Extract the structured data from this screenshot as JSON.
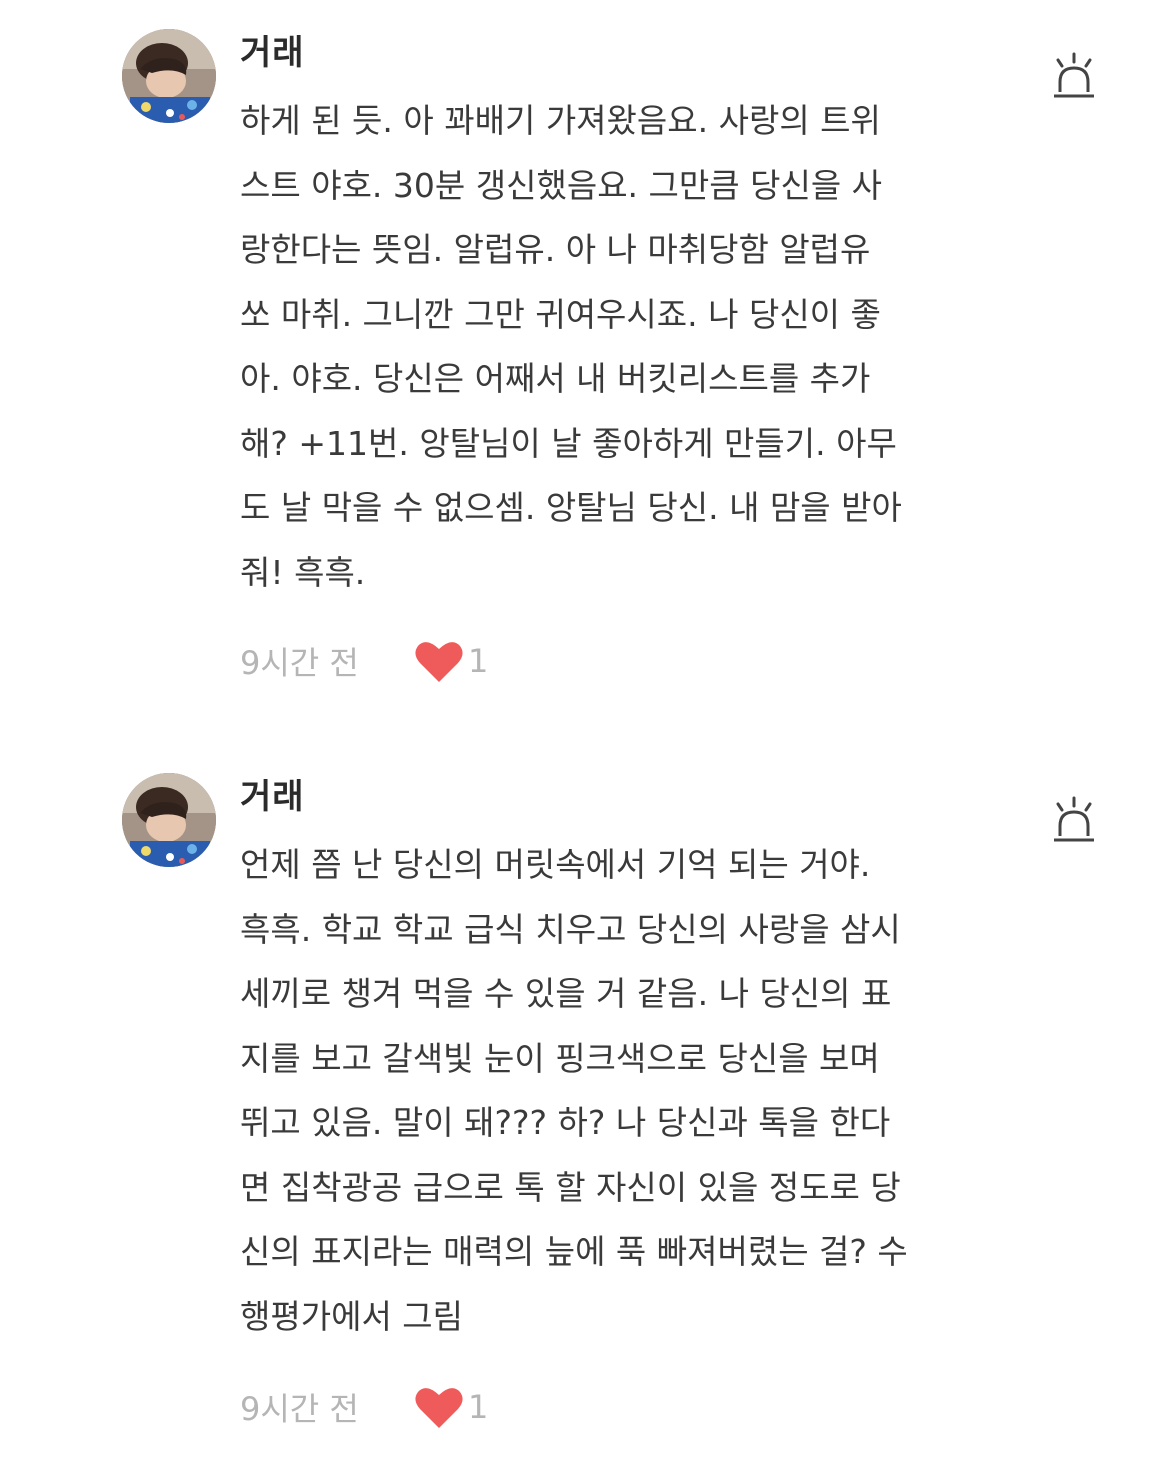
{
  "colors": {
    "heart": "#ef5b5b",
    "meta_text": "#b5b5b5",
    "body_text": "#3a3a3a",
    "author_text": "#2b2b2b",
    "icon": "#444444"
  },
  "comments": [
    {
      "author": "거래",
      "avatar_icon": "user-avatar",
      "report_icon": "siren-icon",
      "lines": [
        "하게 된 듯. 아 꽈배기 가져왔음요. 사랑의 트위",
        "스트 야호. 30분 갱신했음요. 그만큼 당신을 사",
        "랑한다는 뜻임. 알럽유. 아 나 마취당함 알럽유",
        "쏘 마취. 그니깐 그만 귀여우시죠. 나 당신이 좋",
        "아. 야호. 당신은 어째서 내 버킷리스트를 추가",
        "해? +11번. 앙탈님이 날 좋아하게 만들기. 아무",
        "도 날 막을 수 없으셈. 앙탈님 당신. 내 맘을 받아",
        "줘! 흑흑."
      ],
      "time": "9시간 전",
      "like_icon": "heart-icon",
      "likes": "1"
    },
    {
      "author": "거래",
      "avatar_icon": "user-avatar",
      "report_icon": "siren-icon",
      "lines": [
        "언제 쯤 난 당신의 머릿속에서 기억 되는 거야.",
        "흑흑. 학교 학교 급식 치우고 당신의 사랑을 삼시",
        "세끼로 챙겨 먹을 수 있을 거 같음. 나 당신의 표",
        "지를 보고 갈색빛 눈이 핑크색으로 당신을 보며",
        "뛰고 있음. 말이 돼??? 하? 나 당신과 톡을 한다",
        "면 집착광공 급으로 톡 할 자신이 있을 정도로 당",
        "신의 표지라는 매력의 늪에 푹 빠져버렸는 걸? 수",
        "행평가에서 그림"
      ],
      "time": "9시간 전",
      "like_icon": "heart-icon",
      "likes": "1"
    }
  ]
}
